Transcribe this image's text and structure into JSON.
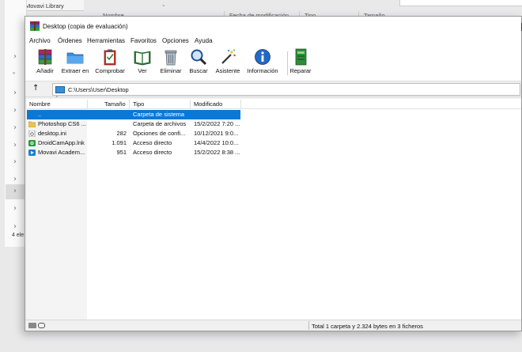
{
  "background_explorer": {
    "top_folder": "Movavi Library",
    "columns": [
      "Nombre",
      "Fecha de modificación",
      "Tipo",
      "Tamaño"
    ],
    "status": "4 ele"
  },
  "window": {
    "title": "Desktop (copia de evaluación)"
  },
  "menu": [
    "Archivo",
    "Órdenes",
    "Herramientas",
    "Favoritos",
    "Opciones",
    "Ayuda"
  ],
  "toolbar": [
    {
      "label": "Añadir",
      "icon": "add-archive-icon"
    },
    {
      "label": "Extraer en",
      "icon": "extract-folder-icon"
    },
    {
      "label": "Comprobar",
      "icon": "test-clipboard-icon"
    },
    {
      "label": "Ver",
      "icon": "view-book-icon"
    },
    {
      "label": "Eliminar",
      "icon": "trash-icon"
    },
    {
      "label": "Buscar",
      "icon": "magnifier-icon"
    },
    {
      "label": "Asistente",
      "icon": "wizard-wand-icon"
    },
    {
      "label": "Información",
      "icon": "info-icon"
    },
    {
      "label": "Reparar",
      "icon": "repair-kit-icon"
    }
  ],
  "address": {
    "path": "C:\\Users\\User\\Desktop"
  },
  "columns": [
    "Nombre",
    "Tamaño",
    "Tipo",
    "Modificado"
  ],
  "files": [
    {
      "name": "..",
      "size": "",
      "type": "Carpeta de sistema",
      "modified": "",
      "icon": "parent-folder-icon",
      "selected": true
    },
    {
      "name": "Photoshop CS6 ...",
      "size": "",
      "type": "Carpeta de archivos",
      "modified": "15/2/2022 7:20 ...",
      "icon": "folder-icon",
      "selected": false
    },
    {
      "name": "desktop.ini",
      "size": "282",
      "type": "Opciones de confi...",
      "modified": "10/12/2021 9:0...",
      "icon": "settings-file-icon",
      "selected": false
    },
    {
      "name": "DroidCamApp.lnk",
      "size": "1.091",
      "type": "Acceso directo",
      "modified": "14/4/2022 10:0...",
      "icon": "droidcam-shortcut-icon",
      "selected": false
    },
    {
      "name": "Movavi Academ...",
      "size": "951",
      "type": "Acceso directo",
      "modified": "15/2/2022 8:38 ...",
      "icon": "movavi-shortcut-icon",
      "selected": false
    }
  ],
  "status": {
    "summary": "Total 1 carpeta y 2.324 bytes en 3 ficheros"
  },
  "colors": {
    "selection": "#0a78d7",
    "window_bg": "#f0f0f0"
  }
}
